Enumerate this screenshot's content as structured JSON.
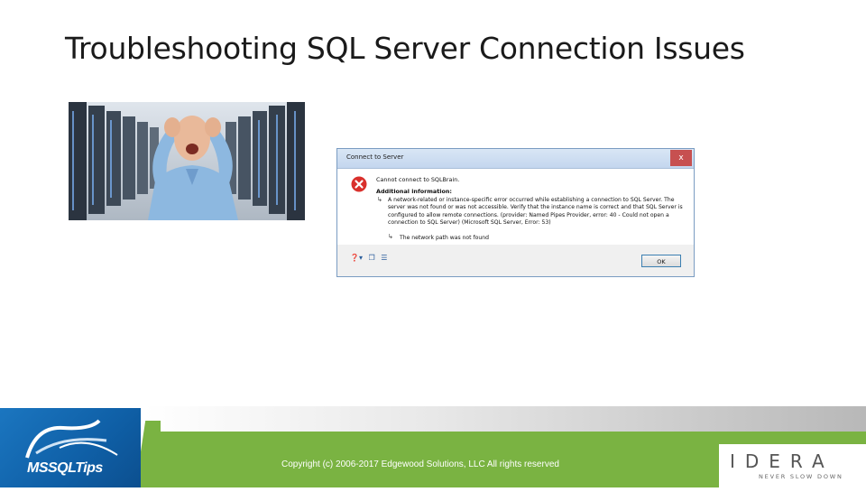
{
  "slide": {
    "title": "Troubleshooting SQL Server Connection Issues"
  },
  "dialog": {
    "title": "Connect to Server",
    "close_label": "x",
    "heading": "Cannot connect to SQLBrain.",
    "subheading": "Additional information:",
    "detail": "A network-related or instance-specific error occurred while establishing a connection to SQL Server. The server was not found or was not accessible. Verify that the instance name is correct and that SQL Server is configured to allow remote connections. (provider: Named Pipes Provider, error: 40 - Could not open a connection to SQL Server) (Microsoft SQL Server, Error: 53)",
    "inner_error": "The network path was not found",
    "ok_label": "OK",
    "toolbar_icons": [
      "help-icon",
      "copy-icon",
      "details-icon"
    ]
  },
  "footer": {
    "logo_text": "MSSQLTips",
    "copyright": "Copyright (c) 2006-2017 Edgewood Solutions, LLC All rights reserved",
    "partner_name": "IDERA",
    "partner_tagline": "NEVER SLOW DOWN",
    "colors": {
      "green": "#7ab342",
      "blue": "#1b76c0"
    }
  }
}
